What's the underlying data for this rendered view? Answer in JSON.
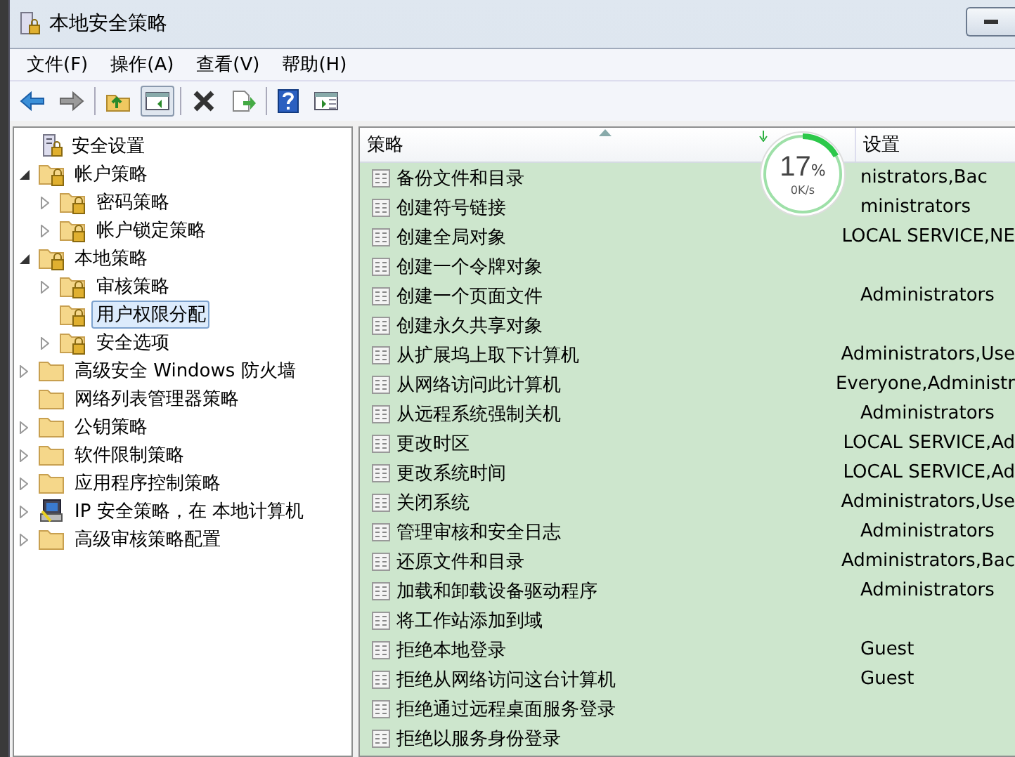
{
  "window": {
    "title": "本地安全策略"
  },
  "menu": [
    "文件(F)",
    "操作(A)",
    "查看(V)",
    "帮助(H)"
  ],
  "toolbar": [
    {
      "kind": "back",
      "selected": false
    },
    {
      "kind": "forward",
      "selected": false
    },
    {
      "kind": "sep"
    },
    {
      "kind": "up",
      "selected": false
    },
    {
      "kind": "tree",
      "selected": true
    },
    {
      "kind": "sep"
    },
    {
      "kind": "delete",
      "selected": false
    },
    {
      "kind": "export",
      "selected": false
    },
    {
      "kind": "sep"
    },
    {
      "kind": "help",
      "selected": false
    },
    {
      "kind": "panel",
      "selected": false
    }
  ],
  "tree": [
    {
      "label": "安全设置",
      "kind": "root",
      "selected": false,
      "children": [
        {
          "label": "帐户策略",
          "kind": "lock",
          "expanded": true,
          "selected": false,
          "children": [
            {
              "label": "密码策略",
              "kind": "lock",
              "expanded": false,
              "selected": false
            },
            {
              "label": "帐户锁定策略",
              "kind": "lock",
              "expanded": false,
              "selected": false
            }
          ]
        },
        {
          "label": "本地策略",
          "kind": "lock",
          "expanded": true,
          "selected": false,
          "children": [
            {
              "label": "审核策略",
              "kind": "lock",
              "expanded": false,
              "selected": false
            },
            {
              "label": "用户权限分配",
              "kind": "lock",
              "selected": true
            },
            {
              "label": "安全选项",
              "kind": "lock",
              "expanded": false,
              "selected": false
            }
          ]
        },
        {
          "label": "高级安全 Windows 防火墙",
          "kind": "folder",
          "expanded": false,
          "selected": false
        },
        {
          "label": "网络列表管理器策略",
          "kind": "folder",
          "selected": false
        },
        {
          "label": "公钥策略",
          "kind": "folder",
          "expanded": false,
          "selected": false
        },
        {
          "label": "软件限制策略",
          "kind": "folder",
          "expanded": false,
          "selected": false
        },
        {
          "label": "应用程序控制策略",
          "kind": "folder",
          "expanded": false,
          "selected": false
        },
        {
          "label": "IP 安全策略，在 本地计算机",
          "kind": "computer",
          "expanded": false,
          "selected": false
        },
        {
          "label": "高级审核策略配置",
          "kind": "folder",
          "expanded": false,
          "selected": false
        }
      ]
    }
  ],
  "table": {
    "columns": [
      "策略",
      "设置"
    ],
    "rows": [
      {
        "policy": "备份文件和目录",
        "setting": "nistrators,Bac"
      },
      {
        "policy": "创建符号链接",
        "setting": "ministrators"
      },
      {
        "policy": "创建全局对象",
        "setting": "LOCAL SERVICE,NE"
      },
      {
        "policy": "创建一个令牌对象"
      },
      {
        "policy": "创建一个页面文件",
        "setting": "Administrators"
      },
      {
        "policy": "创建永久共享对象"
      },
      {
        "policy": "从扩展坞上取下计算机",
        "setting": "Administrators,Use"
      },
      {
        "policy": "从网络访问此计算机",
        "setting": "Everyone,Administr"
      },
      {
        "policy": "从远程系统强制关机",
        "setting": "Administrators"
      },
      {
        "policy": "更改时区",
        "setting": "LOCAL SERVICE,Ad"
      },
      {
        "policy": "更改系统时间",
        "setting": "LOCAL SERVICE,Ad"
      },
      {
        "policy": "关闭系统",
        "setting": "Administrators,Use"
      },
      {
        "policy": "管理审核和安全日志",
        "setting": "Administrators"
      },
      {
        "policy": "还原文件和目录",
        "setting": "Administrators,Bac"
      },
      {
        "policy": "加载和卸载设备驱动程序",
        "setting": "Administrators"
      },
      {
        "policy": "将工作站添加到域"
      },
      {
        "policy": "拒绝本地登录",
        "setting": "Guest"
      },
      {
        "policy": "拒绝从网络访问这台计算机",
        "setting": "Guest"
      },
      {
        "policy": "拒绝通过远程桌面服务登录"
      },
      {
        "policy": "拒绝以服务身份登录"
      }
    ]
  },
  "meter": {
    "value": "17",
    "unit": "%",
    "speed": "0K/s",
    "level": 0.17
  }
}
